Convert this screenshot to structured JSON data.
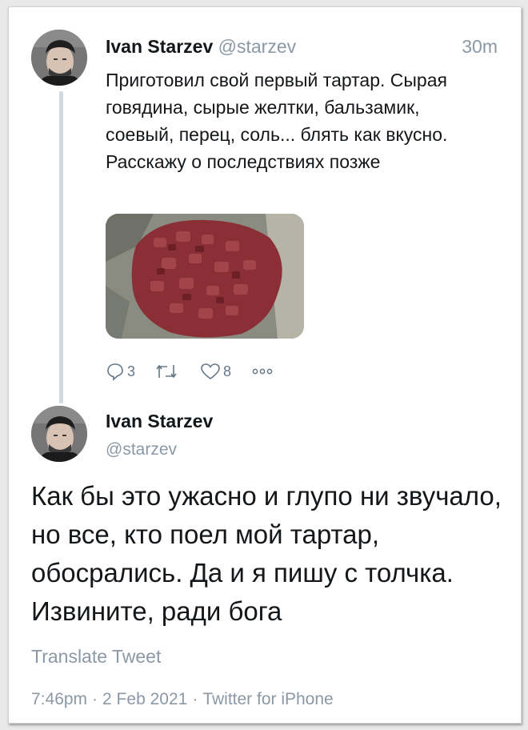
{
  "thread": {
    "tweet1": {
      "name": "Ivan Starzev",
      "handle": "@starzev",
      "time": "30m",
      "text": "Приготовил свой первый тартар. Сырая говядина, сырые желтки, бальзамик, соевый, перец, соль... блять как вкусно. Расскажу о последствиях позже",
      "replies": "3",
      "retweets": "",
      "likes": "8"
    },
    "tweet2": {
      "name": "Ivan Starzev",
      "handle": "@starzev",
      "text": "Как бы это ужасно и глупо ни звучало, но все, кто поел мой тартар, обосрались. Да и я пишу с толчка. Извините, ради бога",
      "translate_label": "Translate Tweet",
      "time": "7:46pm",
      "date": "2 Feb 2021",
      "source": "Twitter for iPhone",
      "separator": "·"
    }
  },
  "icons": {
    "reply": "reply-icon",
    "retweet": "retweet-icon",
    "like": "heart-icon",
    "more": "more-icon"
  },
  "colors": {
    "text": "#14171a",
    "secondary": "#8b98a5",
    "thread_line": "#cfd9de",
    "background": "#ffffff"
  }
}
